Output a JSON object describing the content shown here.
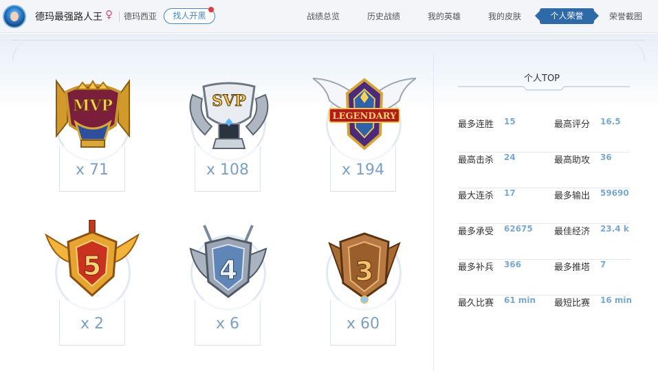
{
  "header": {
    "username": "德玛最强路人王",
    "gender_symbol": "♀",
    "server": "德玛西亚",
    "find_button": "找人开黑"
  },
  "nav": {
    "items": [
      "战绩总览",
      "历史战绩",
      "我的英雄",
      "我的皮肤",
      "个人荣誉",
      "荣誉截图"
    ],
    "active": "个人荣誉"
  },
  "badges": [
    {
      "name": "MVP",
      "count": "x 71",
      "icon": "mvp-trophy-icon"
    },
    {
      "name": "SVP",
      "count": "x 108",
      "icon": "svp-trophy-icon"
    },
    {
      "name": "LEGENDARY",
      "count": "x 194",
      "icon": "legendary-wing-icon"
    },
    {
      "name": "5",
      "count": "x 2",
      "icon": "pentakill-shield-icon"
    },
    {
      "name": "4",
      "count": "x 6",
      "icon": "quadrakill-shield-icon"
    },
    {
      "name": "3",
      "count": "x 60",
      "icon": "triplekill-shield-icon"
    }
  ],
  "top": {
    "title": "个人TOP",
    "stats": [
      [
        {
          "label": "最多连胜",
          "value": "15"
        },
        {
          "label": "最高评分",
          "value": "16.5"
        }
      ],
      [
        {
          "label": "最高击杀",
          "value": "24"
        },
        {
          "label": "最高助攻",
          "value": "36"
        }
      ],
      [
        {
          "label": "最大连杀",
          "value": "17"
        },
        {
          "label": "最多输出",
          "value": "59690"
        }
      ],
      [
        {
          "label": "最多承受",
          "value": "62675"
        },
        {
          "label": "最佳经济",
          "value": "23.4 k"
        }
      ],
      [
        {
          "label": "最多补兵",
          "value": "366"
        },
        {
          "label": "最多推塔",
          "value": "7"
        }
      ],
      [
        {
          "label": "最久比赛",
          "value": "61 min"
        },
        {
          "label": "最短比赛",
          "value": "16 min"
        }
      ]
    ]
  },
  "colors": {
    "accent": "#2e69a8",
    "count": "#7b9fc4",
    "value": "#7aa8cf",
    "gold": "#e7b53d",
    "red": "#c8321f"
  }
}
